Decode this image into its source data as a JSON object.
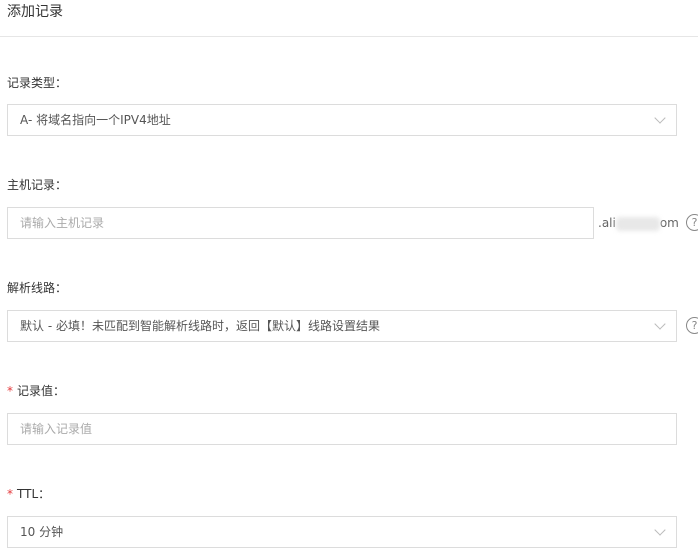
{
  "title": "添加记录",
  "record_type": {
    "label": "记录类型：",
    "value": "A- 将域名指向一个IPV4地址"
  },
  "host": {
    "label": "主机记录：",
    "placeholder": "请输入主机记录",
    "suffix_start": ".ali",
    "suffix_end": "om"
  },
  "line": {
    "label": "解析线路：",
    "value": "默认 - 必填！未匹配到智能解析线路时，返回【默认】线路设置结果"
  },
  "value": {
    "required": "*",
    "label": "记录值：",
    "placeholder": "请输入记录值"
  },
  "ttl": {
    "required": "*",
    "label": "TTL：",
    "value": "10 分钟"
  },
  "help_glyph": "?"
}
